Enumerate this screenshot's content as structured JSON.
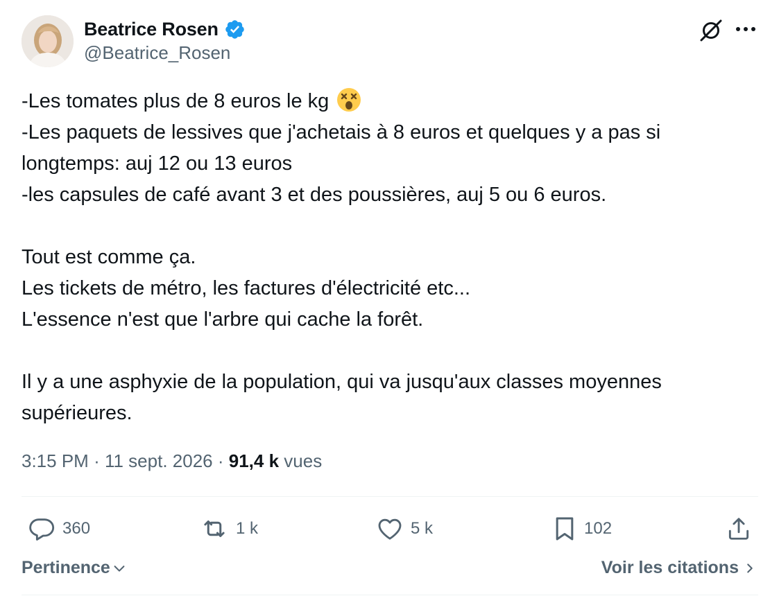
{
  "author": {
    "display_name": "Beatrice Rosen",
    "handle": "@Beatrice_Rosen",
    "verified": true,
    "verified_color": "#1d9bf0"
  },
  "tweet": {
    "lines": [
      "-Les tomates plus de 8 euros le kg",
      "-Les paquets de lessives que j'achetais à 8 euros et quelques y a pas si longtemps: auj 12 ou 13 euros",
      "-les capsules de café avant 3 et des poussières, auj 5 ou 6 euros.",
      "",
      "Tout est comme ça.",
      "Les tickets de métro, les factures d'électricité etc...",
      "L'essence n'est que l'arbre qui cache la forêt.",
      "",
      "Il y a une asphyxie de la population, qui va jusqu'aux classes moyennes supérieures."
    ],
    "emoji": "dizzy-face-icon"
  },
  "meta": {
    "time": "3:15 PM",
    "separator": "·",
    "date": "11 sept. 2026",
    "views_count": "91,4 k",
    "views_label": "vues"
  },
  "actions": {
    "replies": "360",
    "reposts": "1 k",
    "likes": "5 k",
    "bookmarks": "102"
  },
  "footer": {
    "sort_label": "Pertinence",
    "quotes_label": "Voir les citations"
  },
  "colors": {
    "text_primary": "#0f1419",
    "text_secondary": "#536471",
    "divider": "#eff3f4",
    "accent": "#1d9bf0"
  }
}
